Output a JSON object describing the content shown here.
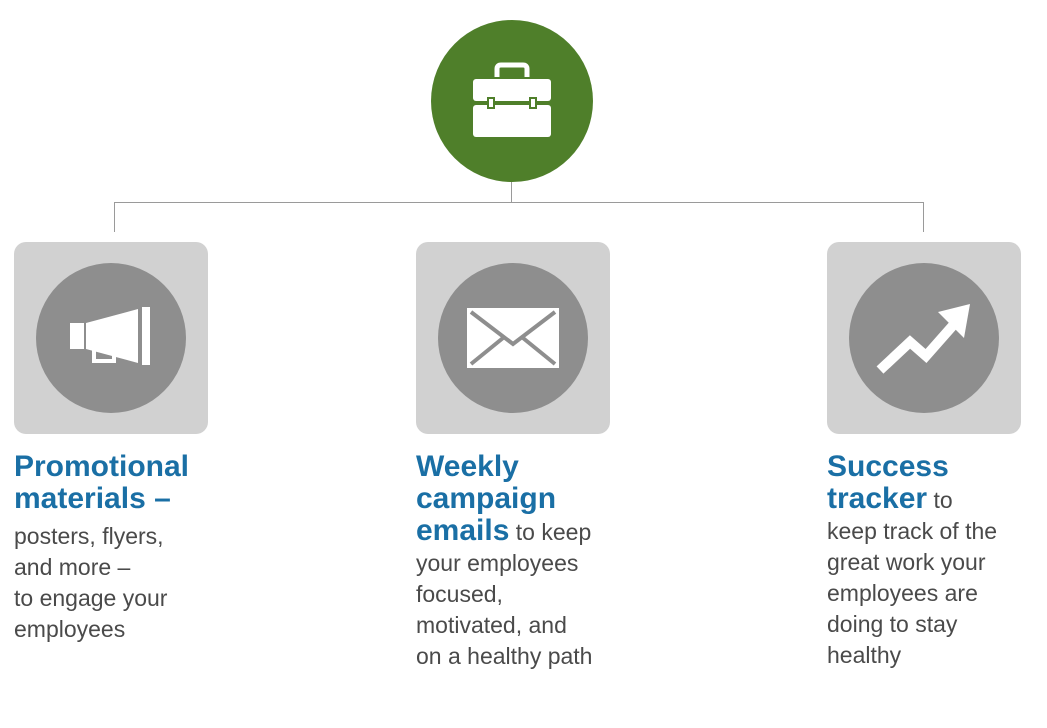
{
  "colors": {
    "top_circle": "#4f7f2a",
    "tile_bg": "#d1d1d1",
    "icon_circle": "#8e8e8e",
    "title_text": "#1a6fa5",
    "body_text": "#4a4a4a",
    "connector": "#9a9a9a"
  },
  "top": {
    "icon": "briefcase-icon"
  },
  "columns": [
    {
      "icon": "megaphone-icon",
      "title_lines": [
        "Promotional",
        "materials –"
      ],
      "title_tail": "",
      "inline_text": "",
      "body_lines": [
        "posters, flyers,",
        "and more –",
        "to engage your",
        "employees"
      ]
    },
    {
      "icon": "envelope-icon",
      "title_lines": [
        "Weekly",
        "campaign"
      ],
      "title_tail": "emails",
      "inline_text": " to keep",
      "body_lines": [
        "your employees",
        "focused,",
        "motivated, and",
        "on a healthy path"
      ]
    },
    {
      "icon": "trending-up-icon",
      "title_lines": [
        "Success"
      ],
      "title_tail": "tracker",
      "inline_text": " to",
      "body_lines": [
        "keep track of the",
        "great work your",
        "employees are",
        "doing to stay",
        "healthy"
      ]
    }
  ]
}
